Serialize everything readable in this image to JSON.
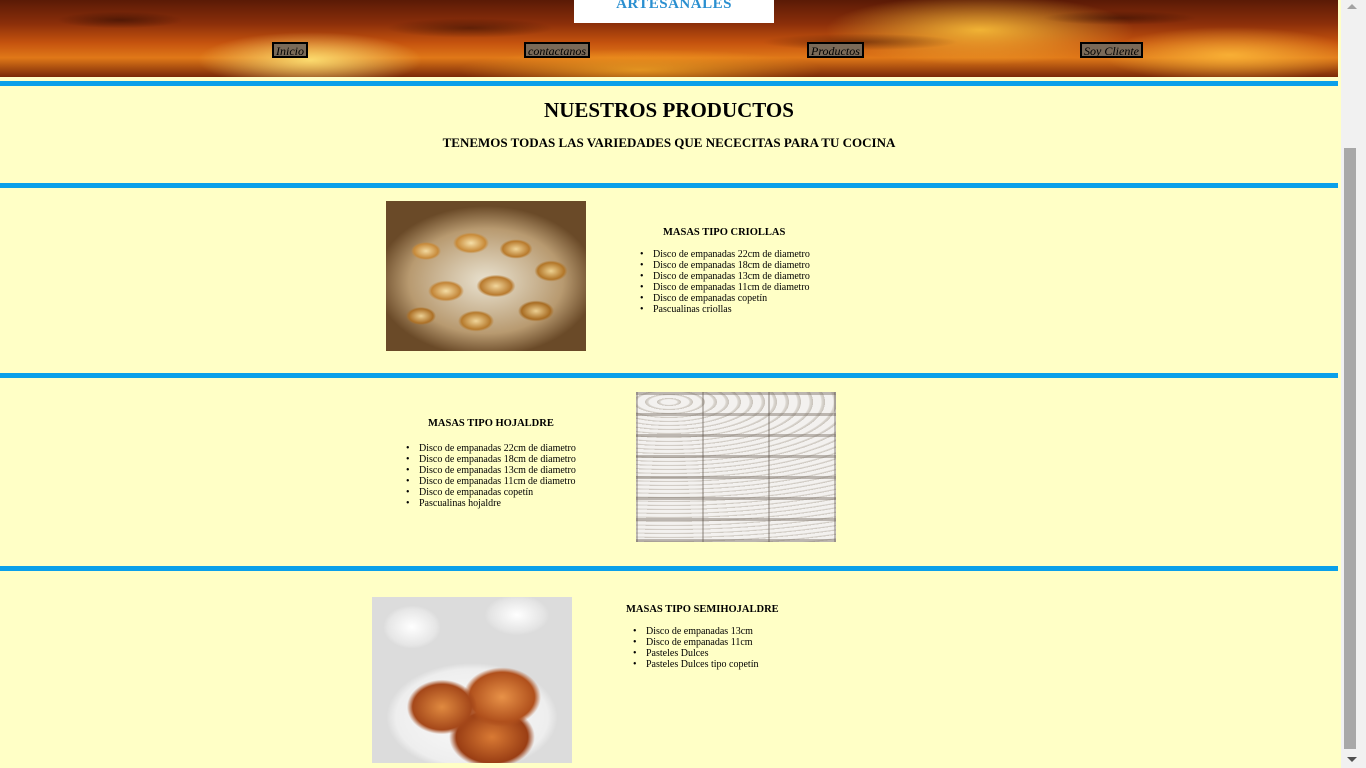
{
  "header": {
    "logo_text": "ARTESANALES",
    "nav": [
      {
        "label": "Inicio"
      },
      {
        "label": "contactanos"
      },
      {
        "label": "Productos"
      },
      {
        "label": "Soy Cliente"
      }
    ]
  },
  "intro": {
    "title": "NUESTROS PRODUCTOS",
    "subtitle": "TENEMOS TODAS LAS VARIEDADES QUE NECECITAS PARA TU COCINA"
  },
  "sections": [
    {
      "title": "MASAS TIPO CRIOLLAS",
      "image": "baked-empanadas-basket",
      "items": [
        "Disco de empanadas 22cm de diametro",
        "Disco de empanadas 18cm de diametro",
        "Disco de empanadas 13cm de diametro",
        "Disco de empanadas 11cm de diametro",
        "Disco de empanadas copetín",
        "Pascualinas criollas"
      ]
    },
    {
      "title": "MASAS TIPO HOJALDRE",
      "image": "raw-empanadas-rows",
      "items": [
        "Disco de empanadas 22cm de diametro",
        "Disco de empanadas 18cm de diametro",
        "Disco de empanadas 13cm de diametro",
        "Disco de empanadas 11cm de diametro",
        "Disco de empanadas copetín",
        "Pascualinas hojaldre"
      ]
    },
    {
      "title": "MASAS TIPO SEMIHOJALDRE",
      "image": "pastries-with-coffee",
      "items": [
        "Disco de empanadas 13cm",
        "Disco de empanadas 11cm",
        "Pasteles Dulces",
        "Pasteles Dulces tipo copetín"
      ]
    }
  ],
  "colors": {
    "page_bg": "#ffffc6",
    "divider": "#0aa0ea",
    "logo": "#2a8fd0"
  }
}
